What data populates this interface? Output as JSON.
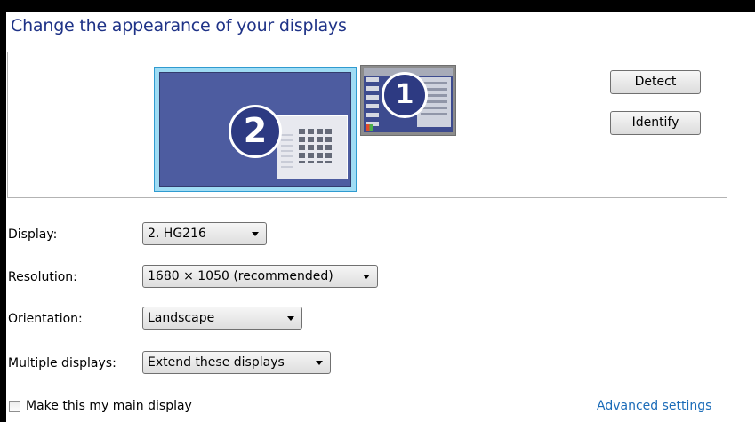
{
  "page": {
    "title": "Change the appearance of your displays"
  },
  "preview": {
    "monitors": [
      {
        "number": "2",
        "selected": true
      },
      {
        "number": "1",
        "selected": false
      }
    ],
    "detect_label": "Detect",
    "identify_label": "Identify"
  },
  "settings": {
    "display": {
      "label": "Display:",
      "value": "2. HG216"
    },
    "resolution": {
      "label": "Resolution:",
      "value": "1680 × 1050 (recommended)"
    },
    "orientation": {
      "label": "Orientation:",
      "value": "Landscape"
    },
    "multiple": {
      "label": "Multiple displays:",
      "value": "Extend these displays"
    }
  },
  "footer": {
    "main_display_label": "Make this my main display",
    "main_display_checked": false,
    "advanced_link": "Advanced settings"
  },
  "colors": {
    "title": "#1e3287",
    "link": "#1a6bb8",
    "selected_monitor_border": "#9fdcf4"
  }
}
